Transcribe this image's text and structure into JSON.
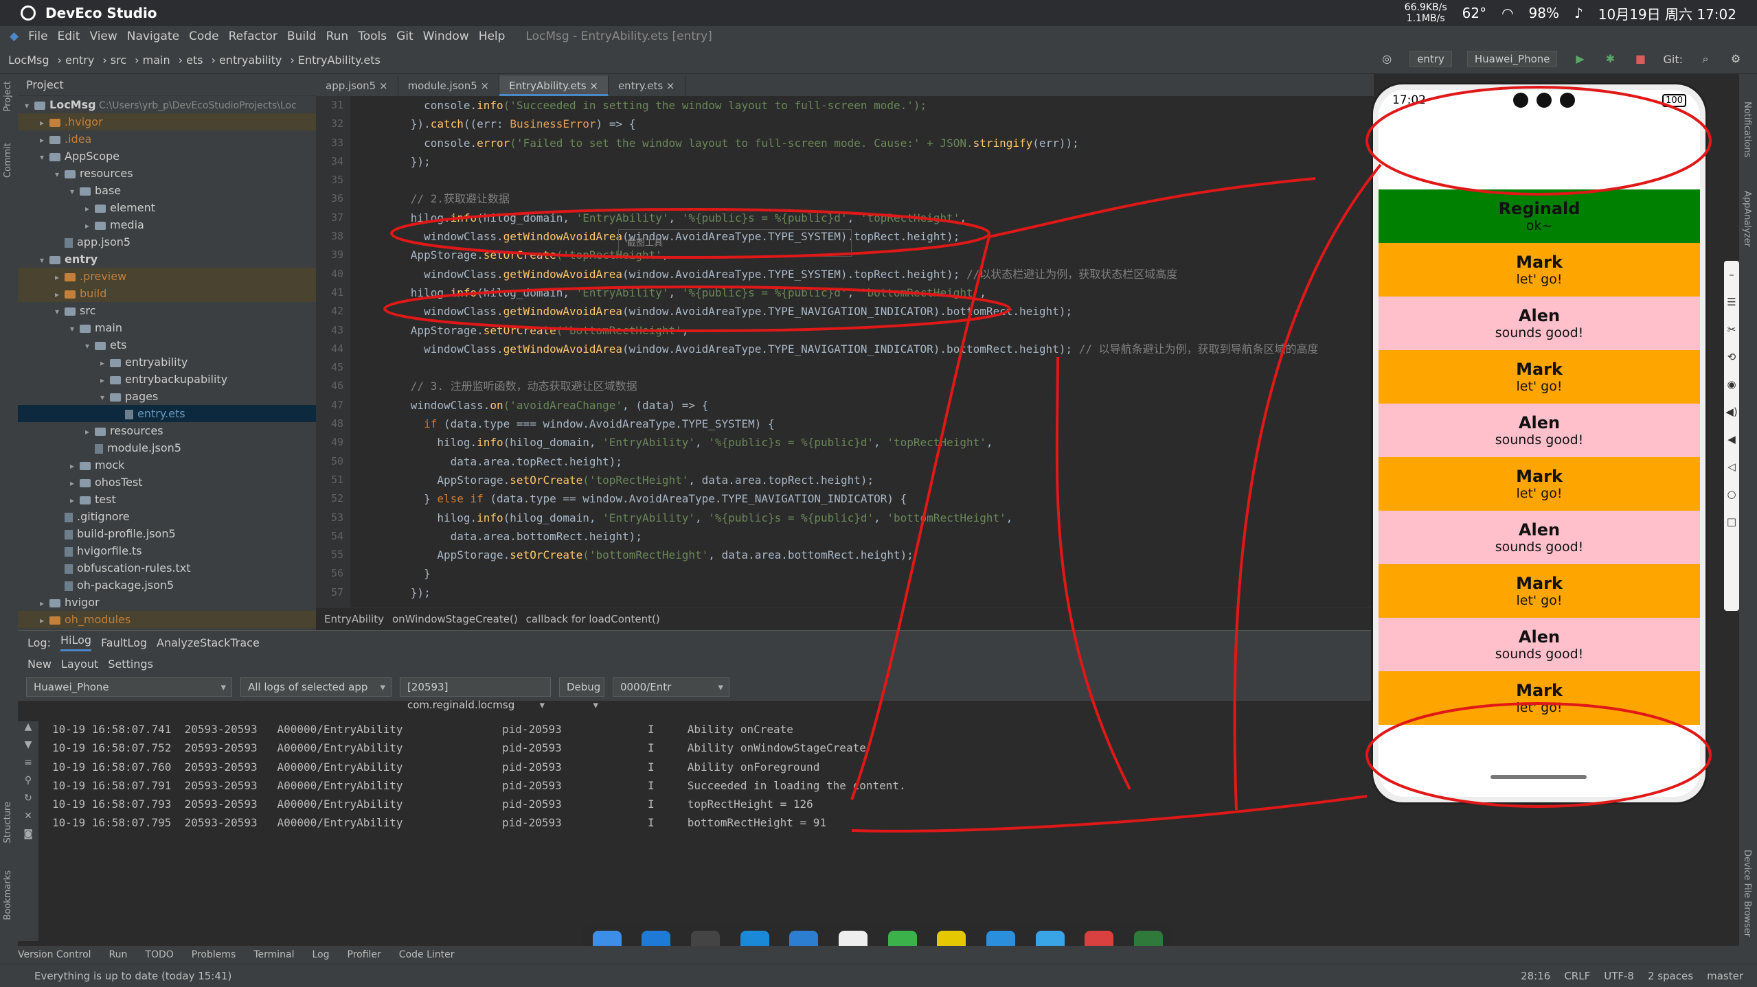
{
  "topbar": {
    "app": "DevEco Studio",
    "net_up": "66.9KB/s",
    "net_down": "1.1MB/s",
    "temp": "62°",
    "battery": "98%",
    "datetime": "10月19日 周六 17:02"
  },
  "menu": [
    "File",
    "Edit",
    "View",
    "Navigate",
    "Code",
    "Refactor",
    "Build",
    "Run",
    "Tools",
    "Git",
    "Window",
    "Help"
  ],
  "window_title": "LocMsg - EntryAbility.ets [entry]",
  "breadcrumb_nav": [
    "LocMsg",
    "entry",
    "src",
    "main",
    "ets",
    "entryability",
    "EntryAbility.ets"
  ],
  "nav_right": {
    "module": "entry",
    "device": "Huawei_Phone",
    "git": "Git:"
  },
  "project": {
    "header": "Project",
    "root_path": "C:\\Users\\yrb_p\\DevEcoStudioProjects\\Loc"
  },
  "tree": [
    {
      "d": 0,
      "t": "LocMsg",
      "k": "folder",
      "arr": "▾",
      "b": true
    },
    {
      "d": 1,
      "t": ".hvigor",
      "k": "folder-orange",
      "arr": "▸",
      "c": "#c2803a",
      "ex": true
    },
    {
      "d": 1,
      "t": ".idea",
      "k": "folder",
      "arr": "▸",
      "c": "#c2803a"
    },
    {
      "d": 1,
      "t": "AppScope",
      "k": "folder",
      "arr": "▾"
    },
    {
      "d": 2,
      "t": "resources",
      "k": "folder",
      "arr": "▾"
    },
    {
      "d": 3,
      "t": "base",
      "k": "folder",
      "arr": "▾"
    },
    {
      "d": 4,
      "t": "element",
      "k": "folder",
      "arr": "▸"
    },
    {
      "d": 4,
      "t": "media",
      "k": "folder",
      "arr": "▸"
    },
    {
      "d": 2,
      "t": "app.json5",
      "k": "file",
      "arr": ""
    },
    {
      "d": 1,
      "t": "entry",
      "k": "folder",
      "arr": "▾",
      "b": true
    },
    {
      "d": 2,
      "t": ".preview",
      "k": "folder-orange",
      "arr": "▸",
      "c": "#c2803a",
      "ex": true
    },
    {
      "d": 2,
      "t": "build",
      "k": "folder-orange",
      "arr": "▸",
      "c": "#c2803a",
      "ex": true
    },
    {
      "d": 2,
      "t": "src",
      "k": "folder",
      "arr": "▾"
    },
    {
      "d": 3,
      "t": "main",
      "k": "folder",
      "arr": "▾"
    },
    {
      "d": 4,
      "t": "ets",
      "k": "folder",
      "arr": "▾"
    },
    {
      "d": 5,
      "t": "entryability",
      "k": "folder",
      "arr": "▸"
    },
    {
      "d": 5,
      "t": "entrybackupability",
      "k": "folder",
      "arr": "▸"
    },
    {
      "d": 5,
      "t": "pages",
      "k": "folder",
      "arr": "▾"
    },
    {
      "d": 6,
      "t": "entry.ets",
      "k": "file",
      "arr": "",
      "sel": true,
      "c": "#6897bb"
    },
    {
      "d": 4,
      "t": "resources",
      "k": "folder",
      "arr": "▸"
    },
    {
      "d": 4,
      "t": "module.json5",
      "k": "file",
      "arr": ""
    },
    {
      "d": 3,
      "t": "mock",
      "k": "folder",
      "arr": "▸"
    },
    {
      "d": 3,
      "t": "ohosTest",
      "k": "folder",
      "arr": "▸"
    },
    {
      "d": 3,
      "t": "test",
      "k": "folder",
      "arr": "▸"
    },
    {
      "d": 2,
      "t": ".gitignore",
      "k": "file",
      "arr": ""
    },
    {
      "d": 2,
      "t": "build-profile.json5",
      "k": "file",
      "arr": ""
    },
    {
      "d": 2,
      "t": "hvigorfile.ts",
      "k": "file",
      "arr": ""
    },
    {
      "d": 2,
      "t": "obfuscation-rules.txt",
      "k": "file",
      "arr": ""
    },
    {
      "d": 2,
      "t": "oh-package.json5",
      "k": "file",
      "arr": ""
    },
    {
      "d": 1,
      "t": "hvigor",
      "k": "folder",
      "arr": "▸"
    },
    {
      "d": 1,
      "t": "oh_modules",
      "k": "folder-orange",
      "arr": "▸",
      "c": "#c2803a",
      "ex": true
    }
  ],
  "tabs": [
    {
      "label": "app.json5"
    },
    {
      "label": "module.json5"
    },
    {
      "label": "EntryAbility.ets",
      "active": true
    },
    {
      "label": "entry.ets"
    }
  ],
  "line_numbers": [
    "31",
    "32",
    "33",
    "34",
    "35",
    "36",
    "37",
    "38",
    "39",
    "40",
    "41",
    "42",
    "43",
    "44",
    "45",
    "46",
    "47",
    "48",
    "49",
    "50",
    "51",
    "52",
    "53",
    "54",
    "55",
    "56",
    "57"
  ],
  "code_lines": [
    [
      [
        "        console.",
        "cls"
      ],
      [
        "info",
        "fn"
      ],
      [
        "('Succeeded in setting the window layout to full-screen mode.');",
        "str"
      ]
    ],
    [
      [
        "      }).",
        "cls"
      ],
      [
        "catch",
        "fn"
      ],
      [
        "((err: ",
        "cls"
      ],
      [
        "BusinessError",
        "org"
      ],
      [
        ") => {",
        "cls"
      ]
    ],
    [
      [
        "        console.",
        "cls"
      ],
      [
        "error",
        "fn"
      ],
      [
        "('Failed to set the window layout to full-screen mode. Cause:' + JSON.",
        "str"
      ],
      [
        "stringify",
        "fn"
      ],
      [
        "(err));",
        "cls"
      ]
    ],
    [
      [
        "      });",
        "cls"
      ]
    ],
    [
      [
        "",
        "cls"
      ]
    ],
    [
      [
        "      // 2.获取避让数据",
        "cm"
      ]
    ],
    [
      [
        "      hilog.",
        "cls"
      ],
      [
        "info",
        "fn"
      ],
      [
        "(hilog_domain, ",
        "cls"
      ],
      [
        "'EntryAbility'",
        "str"
      ],
      [
        ", ",
        "cls"
      ],
      [
        "'%{public}s = %{public}d'",
        "str"
      ],
      [
        ", ",
        "cls"
      ],
      [
        "'topRectHeight'",
        "str"
      ],
      [
        ",",
        "cls"
      ]
    ],
    [
      [
        "        windowClass.",
        "cls"
      ],
      [
        "getWindowAvoidArea",
        "fn"
      ],
      [
        "(window.AvoidAreaType.TYPE_SYSTEM).topRect.height);",
        "cls"
      ]
    ],
    [
      [
        "      AppStorage.",
        "cls"
      ],
      [
        "setOrCreate",
        "fn"
      ],
      [
        "('topRectHeight'",
        "str"
      ],
      [
        ",",
        "cls"
      ]
    ],
    [
      [
        "        windowClass.",
        "cls"
      ],
      [
        "getWindowAvoidArea",
        "fn"
      ],
      [
        "(window.AvoidAreaType.TYPE_SYSTEM).topRect.height); ",
        "cls"
      ],
      [
        "//以状态栏避让为例，获取状态栏区域高度",
        "cm"
      ]
    ],
    [
      [
        "      hilog.",
        "cls"
      ],
      [
        "info",
        "fn"
      ],
      [
        "(hilog_domain, ",
        "cls"
      ],
      [
        "'EntryAbility'",
        "str"
      ],
      [
        ", ",
        "cls"
      ],
      [
        "'%{public}s = %{public}d'",
        "str"
      ],
      [
        ", ",
        "cls"
      ],
      [
        "'bottomRectHeight'",
        "str"
      ],
      [
        ",",
        "cls"
      ]
    ],
    [
      [
        "        windowClass.",
        "cls"
      ],
      [
        "getWindowAvoidArea",
        "fn"
      ],
      [
        "(window.AvoidAreaType.TYPE_NAVIGATION_INDICATOR).bottomRect.height);",
        "cls"
      ]
    ],
    [
      [
        "      AppStorage.",
        "cls"
      ],
      [
        "setOrCreate",
        "fn"
      ],
      [
        "('bottomRectHeight'",
        "str"
      ],
      [
        ",",
        "cls"
      ]
    ],
    [
      [
        "        windowClass.",
        "cls"
      ],
      [
        "getWindowAvoidArea",
        "fn"
      ],
      [
        "(window.AvoidAreaType.TYPE_NAVIGATION_INDICATOR).bottomRect.height); ",
        "cls"
      ],
      [
        "// 以导航条避让为例，获取到导航条区域的高度",
        "cm"
      ]
    ],
    [
      [
        "",
        "cls"
      ]
    ],
    [
      [
        "      // 3. 注册监听函数，动态获取避让区域数据",
        "cm"
      ]
    ],
    [
      [
        "      windowClass.",
        "cls"
      ],
      [
        "on",
        "fn"
      ],
      [
        "('avoidAreaChange'",
        "str"
      ],
      [
        ", (data) => {",
        "cls"
      ]
    ],
    [
      [
        "        ",
        "cls"
      ],
      [
        "if",
        "kw"
      ],
      [
        " (data.type === window.AvoidAreaType.TYPE_SYSTEM) {",
        "cls"
      ]
    ],
    [
      [
        "          hilog.",
        "cls"
      ],
      [
        "info",
        "fn"
      ],
      [
        "(hilog_domain, ",
        "cls"
      ],
      [
        "'EntryAbility'",
        "str"
      ],
      [
        ", ",
        "cls"
      ],
      [
        "'%{public}s = %{public}d'",
        "str"
      ],
      [
        ", ",
        "cls"
      ],
      [
        "'topRectHeight'",
        "str"
      ],
      [
        ",",
        "cls"
      ]
    ],
    [
      [
        "            data.area.topRect.height);",
        "cls"
      ]
    ],
    [
      [
        "          AppStorage.",
        "cls"
      ],
      [
        "setOrCreate",
        "fn"
      ],
      [
        "('topRectHeight'",
        "str"
      ],
      [
        ", data.area.topRect.height);",
        "cls"
      ]
    ],
    [
      [
        "        } ",
        "cls"
      ],
      [
        "else if",
        "kw"
      ],
      [
        " (data.type == window.AvoidAreaType.TYPE_NAVIGATION_INDICATOR) {",
        "cls"
      ]
    ],
    [
      [
        "          hilog.",
        "cls"
      ],
      [
        "info",
        "fn"
      ],
      [
        "(hilog_domain, ",
        "cls"
      ],
      [
        "'EntryAbility'",
        "str"
      ],
      [
        ", ",
        "cls"
      ],
      [
        "'%{public}s = %{public}d'",
        "str"
      ],
      [
        ", ",
        "cls"
      ],
      [
        "'bottomRectHeight'",
        "str"
      ],
      [
        ",",
        "cls"
      ]
    ],
    [
      [
        "            data.area.bottomRect.height);",
        "cls"
      ]
    ],
    [
      [
        "          AppStorage.",
        "cls"
      ],
      [
        "setOrCreate",
        "fn"
      ],
      [
        "('bottomRectHeight'",
        "str"
      ],
      [
        ", data.area.bottomRect.height);",
        "cls"
      ]
    ],
    [
      [
        "        }",
        "cls"
      ]
    ],
    [
      [
        "      });",
        "cls"
      ]
    ]
  ],
  "editor_breadcrumb": [
    "EntryAbility",
    "onWindowStageCreate()",
    "callback for loadContent()"
  ],
  "log": {
    "label": "Log:",
    "tabs": [
      "HiLog",
      "FaultLog",
      "AnalyzeStackTrace"
    ],
    "toolbar": [
      "New",
      "Layout",
      "Settings"
    ],
    "filters": {
      "device": "Huawei_Phone",
      "scope": "All logs of selected app",
      "process": "[20593] com.reginald.locmsg",
      "level": "Debug",
      "search": "0000/Entr"
    },
    "rows": [
      [
        "10-19 16:58:07.741",
        "20593-20593",
        "A00000/EntryAbility",
        "pid-20593",
        "I",
        "Ability onCreate"
      ],
      [
        "10-19 16:58:07.752",
        "20593-20593",
        "A00000/EntryAbility",
        "pid-20593",
        "I",
        "Ability onWindowStageCreate"
      ],
      [
        "10-19 16:58:07.760",
        "20593-20593",
        "A00000/EntryAbility",
        "pid-20593",
        "I",
        "Ability onForeground"
      ],
      [
        "10-19 16:58:07.791",
        "20593-20593",
        "A00000/EntryAbility",
        "pid-20593",
        "I",
        "Succeeded in loading the content."
      ],
      [
        "10-19 16:58:07.793",
        "20593-20593",
        "A00000/EntryAbility",
        "pid-20593",
        "I",
        "topRectHeight = 126"
      ],
      [
        "10-19 16:58:07.795",
        "20593-20593",
        "A00000/EntryAbility",
        "pid-20593",
        "I",
        "bottomRectHeight = 91"
      ]
    ]
  },
  "phone": {
    "time": "17:02",
    "battery": "100",
    "items": [
      {
        "name": "Reginald",
        "msg": "ok~",
        "color": "green"
      },
      {
        "name": "Mark",
        "msg": "let' go!",
        "color": "orange"
      },
      {
        "name": "Alen",
        "msg": "sounds good!",
        "color": "pink"
      },
      {
        "name": "Mark",
        "msg": "let' go!",
        "color": "orange"
      },
      {
        "name": "Alen",
        "msg": "sounds good!",
        "color": "pink"
      },
      {
        "name": "Mark",
        "msg": "let' go!",
        "color": "orange"
      },
      {
        "name": "Alen",
        "msg": "sounds good!",
        "color": "pink"
      },
      {
        "name": "Mark",
        "msg": "let' go!",
        "color": "orange"
      },
      {
        "name": "Alen",
        "msg": "sounds good!",
        "color": "pink"
      },
      {
        "name": "Mark",
        "msg": "let' go!",
        "color": "orange"
      }
    ]
  },
  "bottom_tools": [
    "Version Control",
    "Run",
    "TODO",
    "Problems",
    "Terminal",
    "Log",
    "Profiler",
    "Code Linter"
  ],
  "statusbar": {
    "message": "Everything is up to date (today 15:41)",
    "pos": "28:16",
    "eol": "CRLF",
    "enc": "UTF-8",
    "indent": "2 spaces",
    "branch": "master"
  },
  "left_strip": [
    "Project",
    "Commit",
    "Structure",
    "Bookmarks"
  ],
  "right_strip": [
    "Notifications",
    "AppAnalyzer",
    "Device File Browser"
  ],
  "overlay": {
    "title": "截图工具"
  }
}
